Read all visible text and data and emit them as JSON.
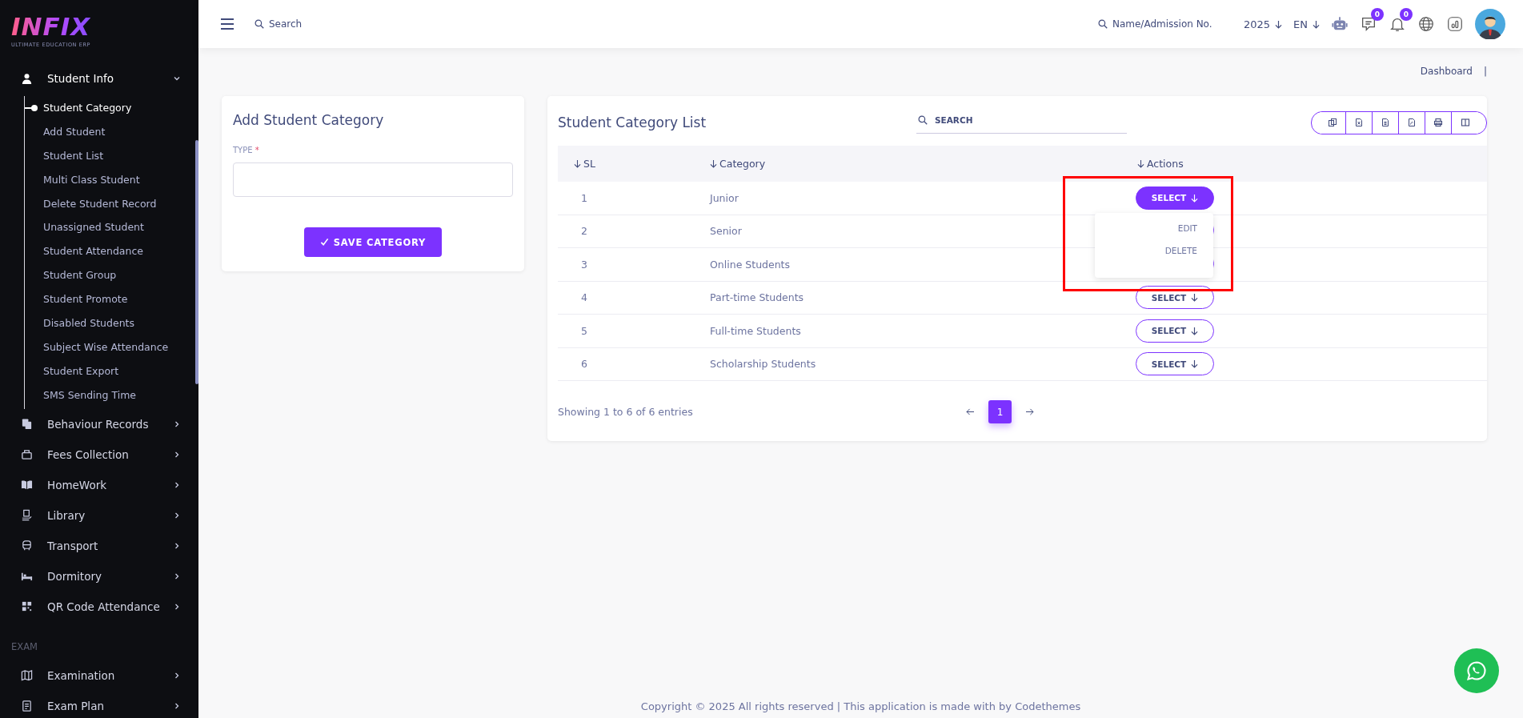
{
  "sidebar": {
    "logo": {
      "title": "INFIX",
      "subtitle": "ULTIMATE EDUCATION ERP"
    },
    "menu": [
      {
        "label": "Student Info",
        "kind": "person",
        "expanded": true,
        "children": [
          {
            "label": "Student Category",
            "selected": true
          },
          {
            "label": "Add Student",
            "selected": false
          },
          {
            "label": "Student List",
            "selected": false
          },
          {
            "label": "Multi Class Student",
            "selected": false
          },
          {
            "label": "Delete Student Record",
            "selected": false
          },
          {
            "label": "Unassigned Student",
            "selected": false
          },
          {
            "label": "Student Attendance",
            "selected": false
          },
          {
            "label": "Student Group",
            "selected": false
          },
          {
            "label": "Student Promote",
            "selected": false
          },
          {
            "label": "Disabled Students",
            "selected": false
          },
          {
            "label": "Subject Wise Attendance",
            "selected": false
          },
          {
            "label": "Student Export",
            "selected": false
          },
          {
            "label": "SMS Sending Time",
            "selected": false
          }
        ]
      },
      {
        "label": "Behaviour Records",
        "kind": "files",
        "expanded": false
      },
      {
        "label": "Fees Collection",
        "kind": "wallet",
        "expanded": false
      },
      {
        "label": "HomeWork",
        "kind": "book",
        "expanded": false
      },
      {
        "label": "Library",
        "kind": "library",
        "expanded": false
      },
      {
        "label": "Transport",
        "kind": "bus",
        "expanded": false
      },
      {
        "label": "Dormitory",
        "kind": "bed",
        "expanded": false
      },
      {
        "label": "QR Code Attendance",
        "kind": "qr",
        "expanded": false
      }
    ],
    "section_heading": "EXAM",
    "section_menu": [
      {
        "label": "Examination",
        "kind": "map",
        "expanded": false
      },
      {
        "label": "Exam Plan",
        "kind": "clipboard",
        "expanded": false
      }
    ]
  },
  "topbar": {
    "search": {
      "placeholder": "Search"
    },
    "student_search": {
      "placeholder": "Name/Admission No."
    },
    "year": "2025",
    "language": "EN",
    "chat_count": "0",
    "notification_count": "0"
  },
  "breadcrumb": [
    "Dashboard",
    "|"
  ],
  "add_form": {
    "title": "Add Student Category",
    "field": {
      "label": "TYPE",
      "required_mark": "*"
    },
    "submit": "SAVE CATEGORY"
  },
  "list": {
    "title": "Student Category List",
    "search": {
      "placeholder": "SEARCH"
    },
    "columns": [
      "SL",
      "Category",
      "Actions"
    ],
    "rows": [
      {
        "sl": "1",
        "category": "Junior",
        "action": "SELECT",
        "menu_open": true
      },
      {
        "sl": "2",
        "category": "Senior",
        "menu_open": false
      },
      {
        "sl": "3",
        "category": "Online Students",
        "menu_open": false
      },
      {
        "sl": "4",
        "category": "Part-time Students",
        "action": "SELECT",
        "menu_open": false
      },
      {
        "sl": "5",
        "category": "Full-time Students",
        "action": "SELECT",
        "menu_open": false
      },
      {
        "sl": "6",
        "category": "Scholarship Students",
        "action": "SELECT",
        "menu_open": false
      }
    ],
    "dropdown": [
      "EDIT",
      "DELETE"
    ],
    "info": "Showing 1 to 6 of 6 entries",
    "pages": [
      {
        "label": "1",
        "selected": true
      }
    ]
  },
  "footer": "Copyright © 2025 All rights reserved | This application is made with by Codethemes"
}
